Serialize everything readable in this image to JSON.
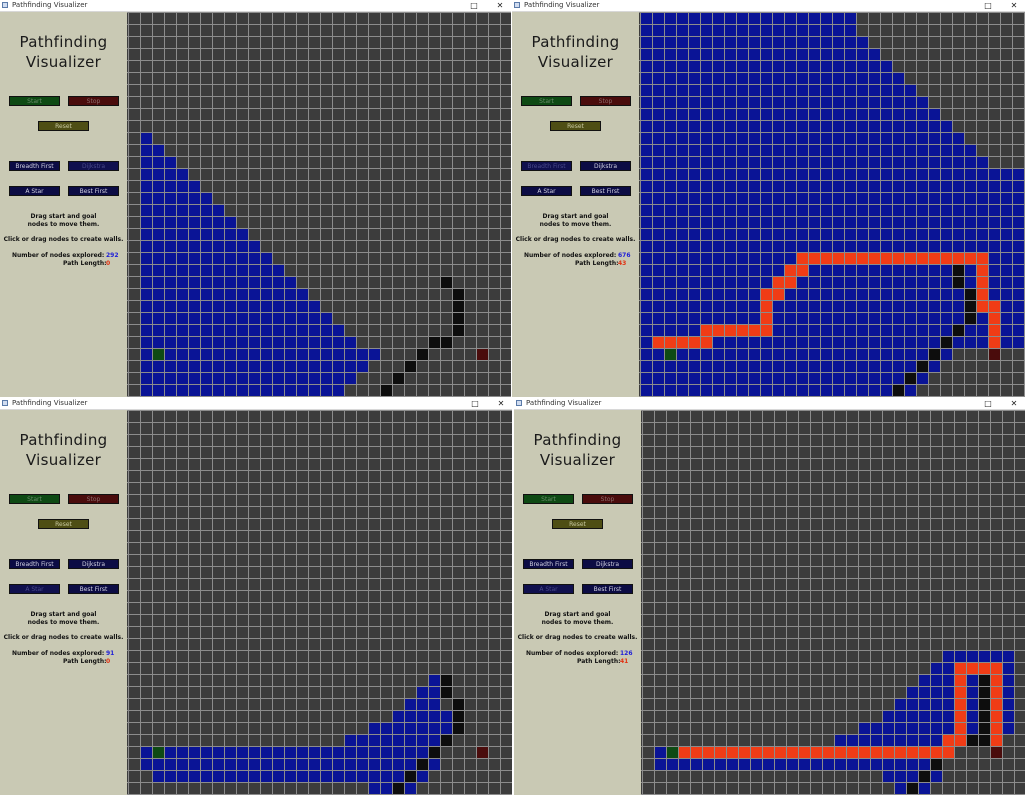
{
  "colors": {
    "panel": "#c9c9b4",
    "grid_bg": "#3c3c3c",
    "grid_line": "#8c8c8c",
    "explored": "#0a1496",
    "wall": "#0d0d0d",
    "path": "#f03c16",
    "start": "#0e4a14",
    "goal": "#4a0c0c",
    "btn_start": "#0e4a14",
    "btn_stop": "#4a0c0c",
    "btn_reset": "#4e4e14",
    "btn_algo": "#0c0c44"
  },
  "icons": {
    "app": "app-window-icon",
    "maximize": "maximize-icon",
    "close": "close-icon"
  },
  "app_title_line1": "Pathfinding",
  "app_title_line2": "Visualizer",
  "buttons": {
    "start": "Start",
    "stop": "Stop",
    "reset": "Reset",
    "breadth_first": "Breadth First",
    "dijkstra": "Dijkstra",
    "astar": "A Star",
    "best_first": "Best First"
  },
  "info": {
    "drag_line1": "Drag start and goal",
    "drag_line2": "nodes to move them.",
    "walls": "Click or drag nodes to create walls.",
    "nodes_label": "Number of nodes explored:",
    "path_label": "Path Length:"
  },
  "windows": [
    {
      "title": "Pathfinding Visualizer",
      "nodes_explored": "292",
      "path_length": "0",
      "active_algorithm": "Dijkstra"
    },
    {
      "title": "Pathfinding Visualizer",
      "nodes_explored": "676",
      "path_length": "43",
      "active_algorithm": "Breadth First"
    },
    {
      "title": "Pathfinding Visualizer",
      "nodes_explored": "91",
      "path_length": "0",
      "active_algorithm": "A Star"
    },
    {
      "title": "Pathfinding Visualizer",
      "nodes_explored": "126",
      "path_length": "41",
      "active_algorithm": "A Star"
    }
  ]
}
